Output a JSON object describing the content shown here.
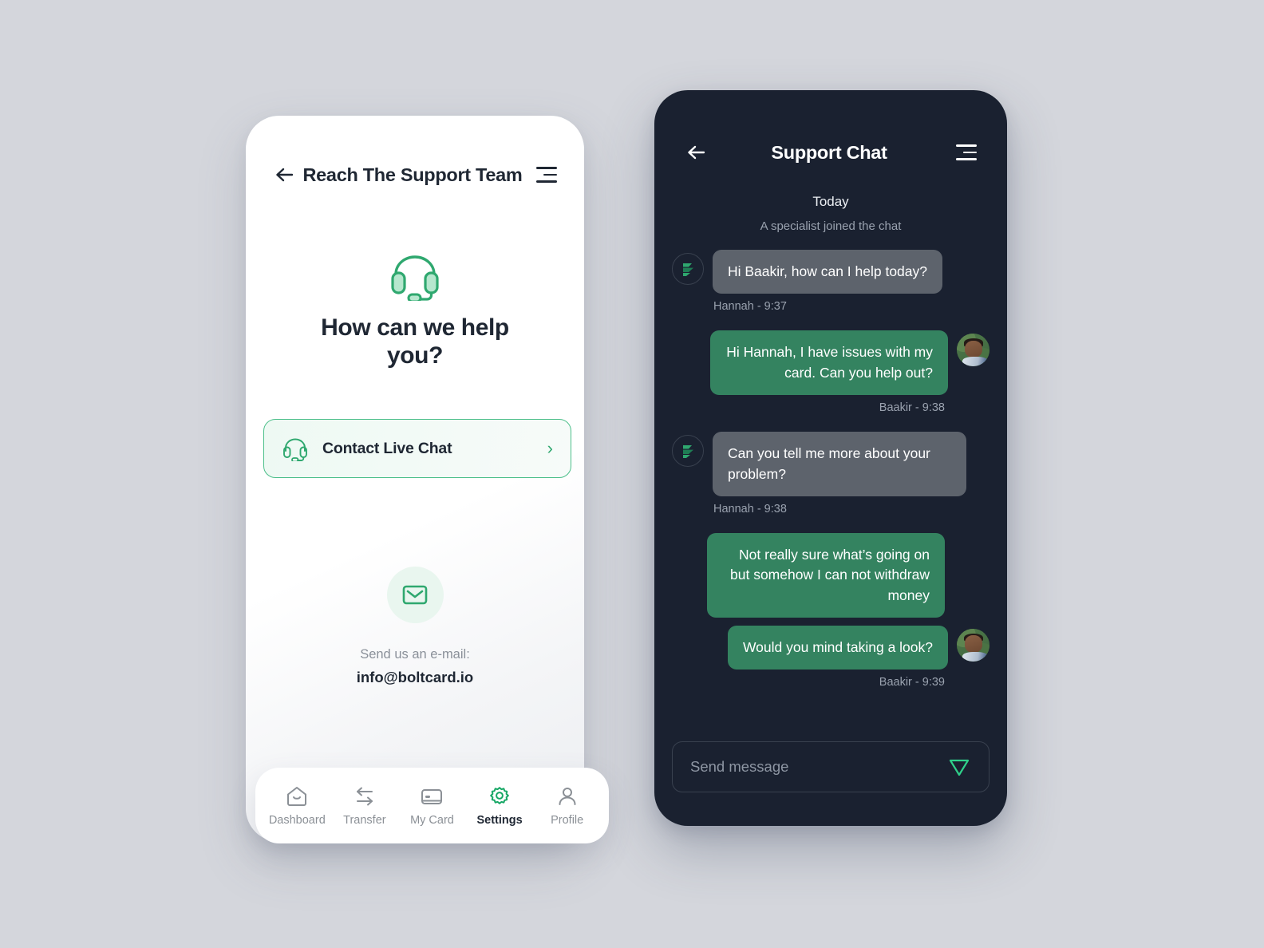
{
  "support_screen": {
    "header": {
      "title": "Reach The Support Team",
      "back_icon": "arrow-left-icon",
      "menu_icon": "hamburger-icon"
    },
    "hero": {
      "icon": "headset-icon",
      "heading": "How can we help you?"
    },
    "live_chat": {
      "icon": "headset-icon",
      "label": "Contact Live Chat",
      "chevron": "›"
    },
    "email": {
      "icon": "envelope-icon",
      "label": "Send us an e-mail:",
      "address": "info@boltcard.io"
    },
    "bottom_nav": [
      {
        "label": "Dashboard",
        "icon": "home-icon",
        "active": false
      },
      {
        "label": "Transfer",
        "icon": "transfer-arrows-icon",
        "active": false
      },
      {
        "label": "My Card",
        "icon": "credit-card-icon",
        "active": false
      },
      {
        "label": "Settings",
        "icon": "gear-icon",
        "active": true
      },
      {
        "label": "Profile",
        "icon": "person-icon",
        "active": false
      }
    ]
  },
  "chat_screen": {
    "header": {
      "title": "Support Chat",
      "back_icon": "arrow-left-icon",
      "menu_icon": "hamburger-icon"
    },
    "day_separator": "Today",
    "system_note": "A specialist joined the chat",
    "messages": [
      {
        "sender": "agent",
        "text": "Hi Baakir, how can I help today?",
        "meta": "Hannah - 9:37",
        "avatar": "brand-logo-avatar"
      },
      {
        "sender": "user",
        "text": "Hi Hannah, I have issues with my card. Can you help out?",
        "meta": "Baakir - 9:38",
        "avatar": "user-photo-avatar"
      },
      {
        "sender": "agent",
        "text": "Can you tell me more about your problem?",
        "meta": "Hannah - 9:38",
        "avatar": "brand-logo-avatar"
      },
      {
        "sender": "user",
        "text": "Not really sure what’s going on but somehow I can not withdraw money",
        "meta": "",
        "avatar": ""
      },
      {
        "sender": "user",
        "text": "Would you mind taking a look?",
        "meta": "Baakir - 9:39",
        "avatar": "user-photo-avatar"
      }
    ],
    "composer": {
      "placeholder": "Send message",
      "send_icon": "send-paper-plane-icon"
    }
  },
  "colors": {
    "page_background": "#d4d6dc",
    "brand_green": "#2fa86f",
    "accent_green": "#34a06f",
    "user_bubble": "#348360",
    "agent_bubble": "#5d636c",
    "dark_surface": "#1a2130",
    "ink": "#1f2733",
    "muted": "#8b9096"
  }
}
